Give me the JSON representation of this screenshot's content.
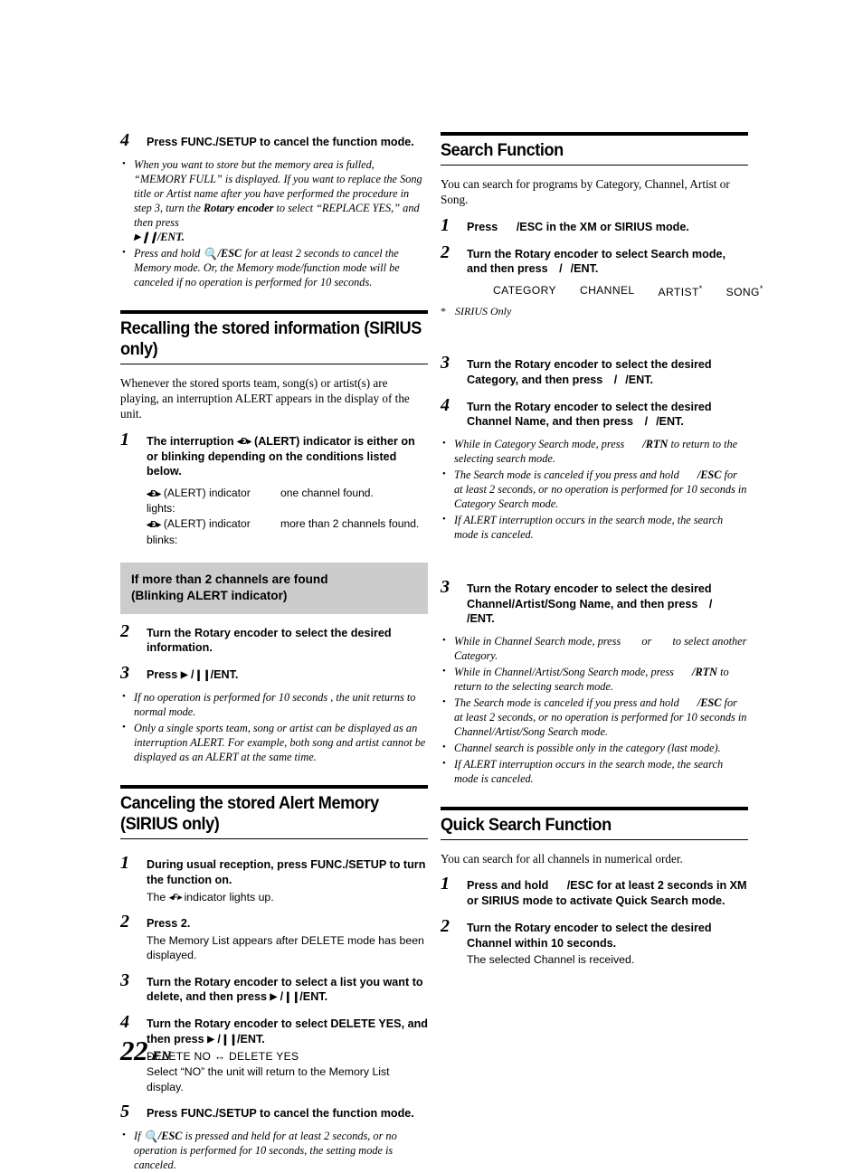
{
  "page": {
    "number": "22",
    "suffix": "-EN"
  },
  "left_column": {
    "top_step": {
      "num": "4",
      "text_before": "Press ",
      "text_key": "FUNC./SETUP",
      "text_after": " to cancel the function mode."
    },
    "top_notes": [
      {
        "segments": [
          "When you want to store but the memory area is fulled, “MEMORY FULL” is displayed. If you want to replace the Song title or Artist name after you have performed the procedure in step 3, turn the ",
          "Rotary encoder",
          " to select “REPLACE YES,” and then press ",
          "/ENT."
        ]
      },
      {
        "segments": [
          "Press and hold ",
          "/ESC",
          " for at least 2 seconds to cancel the Memory mode. Or, the Memory mode/function mode will be canceled if no operation is performed for 10 seconds."
        ]
      }
    ],
    "section_recalling": {
      "title": "Recalling the stored information (SIRIUS only)",
      "intro": "Whenever the stored sports team, song(s) or artist(s) are playing, an interruption ALERT appears in the display of the unit.",
      "step1": {
        "num": "1",
        "text_a": "The interruption ",
        "text_b": " (ALERT) indicator is either on or blinking depending on the conditions listed below."
      },
      "conditions": [
        {
          "label": "(ALERT) indicator lights:",
          "value": "one channel found."
        },
        {
          "label": "(ALERT) indicator blinks:",
          "value": "more than 2 channels found."
        }
      ],
      "gray_box": {
        "line1": "If more than 2 channels are found",
        "line2": "(Blinking ALERT indicator)"
      },
      "step2": {
        "num": "2",
        "text_a": "Turn the ",
        "bold": "Rotary encoder",
        "text_b": " to select the desired information."
      },
      "step3": {
        "num": "3",
        "text_a": "Press ",
        "text_b": "/ENT."
      },
      "notes": [
        "If no operation is performed for 10 seconds , the unit returns to normal mode.",
        "Only a single sports team, song or artist can be displayed as an interruption ALERT. For example, both song and artist cannot be displayed as an ALERT at the same time."
      ]
    },
    "section_canceling": {
      "title_line1": "Canceling the stored Alert Memory",
      "title_line2": "(SIRIUS only)",
      "step1": {
        "num": "1",
        "text_a": "During usual reception, press ",
        "bold": "FUNC./SETUP",
        "text_b": " to turn the function on.",
        "sub_a": "The ",
        "sub_b": " indicator lights up."
      },
      "step2": {
        "num": "2",
        "text_a": "Press ",
        "bold": "2",
        "text_b": ".",
        "sub": "The Memory List appears after DELETE mode has been displayed."
      },
      "step3": {
        "num": "3",
        "text_a": "Turn the ",
        "bold": "Rotary encoder",
        "text_b": " to select a list you want to delete, and then press ",
        "text_c": "/ENT."
      },
      "step4": {
        "num": "4",
        "text_a": "Turn the ",
        "bold": "Rotary encoder",
        "text_b": " to select DELETE YES, and then press ",
        "text_c": "/ENT.",
        "toggle": "DELETE NO ↔ DELETE YES",
        "sub": "Select “NO” the unit will return to the Memory List display."
      },
      "step5": {
        "num": "5",
        "text_a": "Press ",
        "bold": "FUNC./SETUP",
        "text_b": " to cancel the function mode."
      },
      "note": {
        "a": "If ",
        "b": "/ESC",
        "c": " is pressed and held for at least 2 seconds, or no operation is performed for 10 seconds, the setting mode is canceled."
      }
    }
  },
  "right_column": {
    "section_search": {
      "title": "Search Function",
      "intro": "You can search for programs by Category, Channel, Artist or Song.",
      "step1": {
        "num": "1",
        "text_a": "Press ",
        "bold": "/ESC",
        "text_b": " in the XM or SIRIUS mode."
      },
      "step2": {
        "num": "2",
        "text_a": "Turn the ",
        "bold": "Rotary encoder",
        "text_b": " to select Search mode, and then press ",
        "text_c": "/",
        "text_d": "/ENT."
      },
      "modes": [
        "CATEGORY",
        "CHANNEL",
        "ARTIST",
        "SONG"
      ],
      "mode_star_indices": [
        2,
        3
      ],
      "footnote": "SIRIUS Only",
      "footnote_star": "*",
      "step3": {
        "num": "3",
        "text_a": "Turn the ",
        "bold": "Rotary encoder",
        "text_b": " to select the desired Category, and then press ",
        "text_c": "/",
        "text_d": "/ENT."
      },
      "step4": {
        "num": "4",
        "text_a": "Turn the ",
        "bold": "Rotary encoder",
        "text_b": " to select the desired Channel Name, and then press ",
        "text_c": "/",
        "text_d": "/ENT."
      },
      "notes_a": [
        {
          "a": "While in Category Search mode, press ",
          "b": "/RTN",
          "c": " to return to the selecting search mode."
        },
        {
          "a": "The Search mode is canceled if you press and hold ",
          "b": "/ESC",
          "c": " for at least 2 seconds, or no operation is performed for 10 seconds in Category Search mode."
        },
        {
          "a": "If ALERT interruption occurs in the search mode, the search mode is canceled.",
          "b": "",
          "c": ""
        }
      ],
      "step3b": {
        "num": "3",
        "text_a": "Turn the ",
        "bold": "Rotary encoder",
        "text_b": " to select the desired Channel/Artist/Song Name, and then press ",
        "text_c": "/",
        "text_d": "/ENT."
      },
      "notes_b": [
        {
          "a": "While in Channel Search mode, press ",
          "b": "",
          "c": " or ",
          "d": "",
          "e": " to select another Category."
        },
        {
          "a": "While in Channel/Artist/Song Search mode, press ",
          "b": "/RTN",
          "c": " to return to the selecting search mode."
        },
        {
          "a": "The Search mode is canceled if you press and hold ",
          "b": "/ESC",
          "c": " for at least 2 seconds, or no operation is performed for 10 seconds in Channel/Artist/Song Search mode."
        },
        {
          "a": "Channel search is possible only in the category (last mode).",
          "b": "",
          "c": ""
        },
        {
          "a": "If ALERT interruption occurs in the search mode, the search mode is canceled.",
          "b": "",
          "c": ""
        }
      ]
    },
    "section_quick_search": {
      "title": "Quick Search Function",
      "intro": "You can search for all channels in numerical order.",
      "step1": {
        "num": "1",
        "text_a": "Press and hold ",
        "bold": "/ESC",
        "text_b": " for at least 2 seconds in XM or SIRIUS mode to activate Quick Search mode."
      },
      "step2": {
        "num": "2",
        "text_a": "Turn the ",
        "bold": "Rotary encoder",
        "text_b": " to select the desired Channel within 10 seconds.",
        "sub": "The selected Channel is received."
      }
    }
  },
  "glyphs": {
    "play": "▶",
    "pause": "❙❙",
    "magnifier": "⚲",
    "alert_indicator": "◂A▸",
    "func_indicator": "◂F▸"
  }
}
